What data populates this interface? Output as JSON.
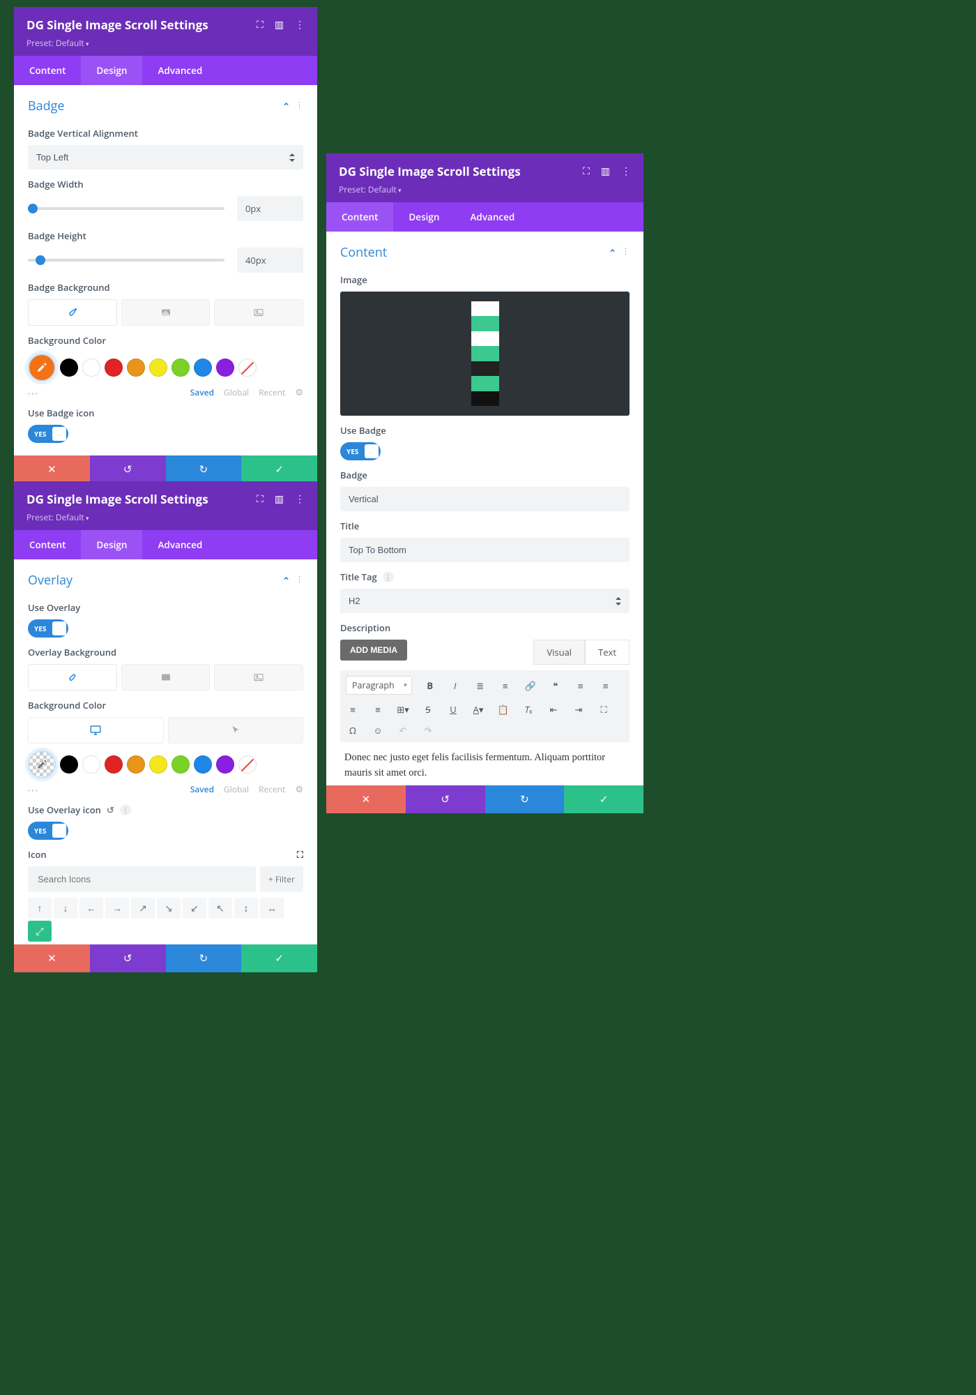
{
  "title": "DG Single Image Scroll Settings",
  "preset": "Preset: Default",
  "tabs": {
    "content": "Content",
    "design": "Design",
    "advanced": "Advanced"
  },
  "footer_labels": {
    "cancel": "✕",
    "undo": "↺",
    "redo": "↻",
    "save": "✓"
  },
  "p1": {
    "activeTab": "design",
    "section": "Badge",
    "fields": {
      "vAlignLabel": "Badge Vertical Alignment",
      "vAlignValue": "Top Left",
      "widthLabel": "Badge Width",
      "widthValue": "0px",
      "heightLabel": "Badge Height",
      "heightValue": "40px",
      "bgLabel": "Badge Background",
      "bgColorLabel": "Background Color",
      "useIconLabel": "Use Badge icon",
      "useIconValue": "YES"
    },
    "colorSelected": "#F47216",
    "swatches": [
      "#000000",
      "#FFFFFF",
      "#E02424",
      "#E8951C",
      "#F3E81E",
      "#7BD226",
      "#2E9F2E",
      "#1F87E5",
      "#8A1FE0",
      "none"
    ],
    "links": {
      "saved": "Saved",
      "global": "Global",
      "recent": "Recent"
    }
  },
  "p2": {
    "activeTab": "design",
    "section": "Overlay",
    "fields": {
      "useOverlayLabel": "Use Overlay",
      "useOverlayValue": "YES",
      "bgLabel": "Overlay Background",
      "bgColorLabel": "Background Color",
      "useIconLabel": "Use Overlay icon",
      "useIconValue": "YES",
      "iconLabel": "Icon",
      "searchPlaceholder": "Search Icons",
      "filterLabel": "+  Filter"
    },
    "swatches": [
      "#000000",
      "#FFFFFF",
      "#E02424",
      "#E8951C",
      "#F3E81E",
      "#7BD226",
      "#2E9F2E",
      "#1F87E5",
      "#8A1FE0",
      "none"
    ],
    "links": {
      "saved": "Saved",
      "global": "Global",
      "recent": "Recent"
    },
    "iconArrows": [
      "↑",
      "↓",
      "←",
      "→",
      "↔",
      "↕",
      "↗",
      "↘",
      "↙",
      "↖",
      "↕",
      "↔",
      "⤡",
      "⤢"
    ]
  },
  "p3": {
    "activeTab": "content",
    "section": "Content",
    "fields": {
      "imageLabel": "Image",
      "useBadgeLabel": "Use Badge",
      "useBadgeValue": "YES",
      "badgeLabel": "Badge",
      "badgeValue": "Vertical",
      "titleLabel": "Title",
      "titleValue": "Top To Bottom",
      "titleTagLabel": "Title Tag",
      "titleTagValue": "H2",
      "descLabel": "Description",
      "addMedia": "ADD MEDIA",
      "edTabVisual": "Visual",
      "edTabText": "Text",
      "paragraph": "Paragraph",
      "descText": "Donec nec justo eget felis facilisis fermentum. Aliquam porttitor mauris sit amet orci."
    }
  }
}
